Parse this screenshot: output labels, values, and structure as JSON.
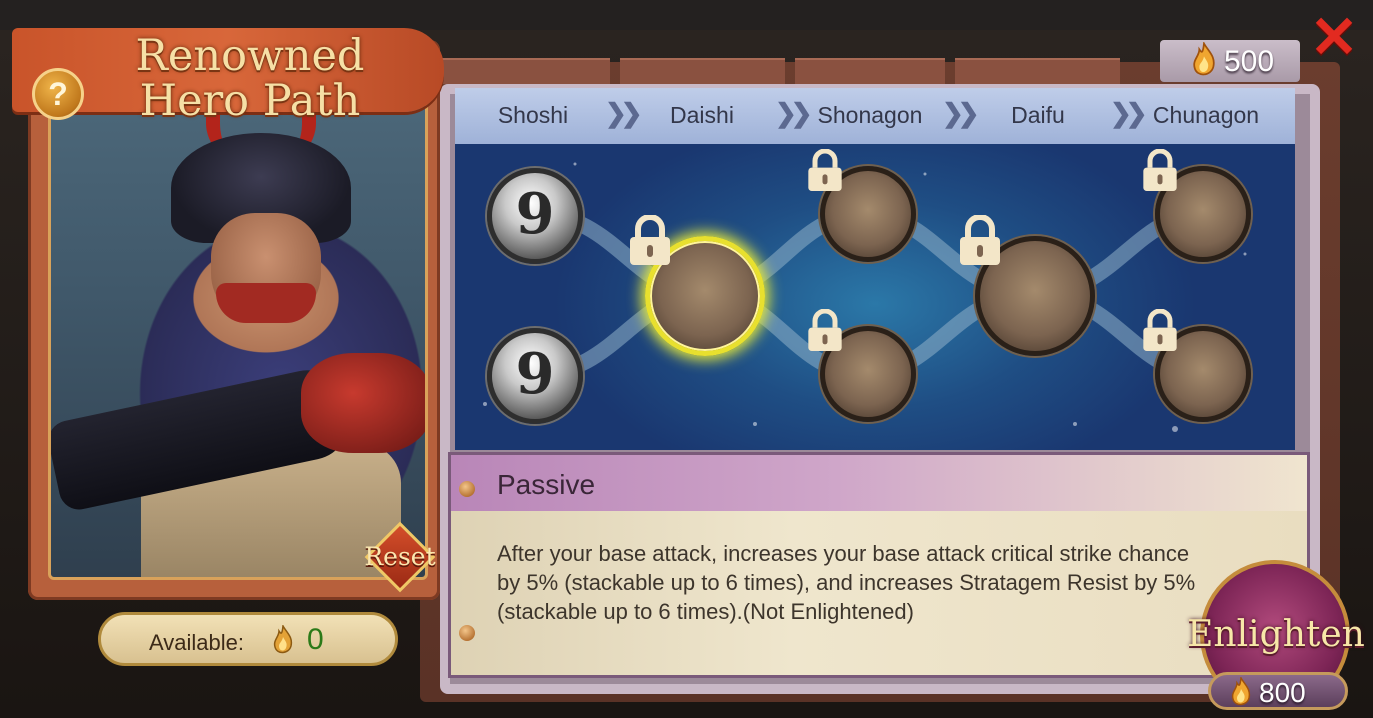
{
  "header": {
    "title_line1": "Renowned",
    "title_line2": "Hero Path",
    "help_icon": "question-mark-icon",
    "help_label": "?"
  },
  "currency": {
    "icon": "flame-coin-icon",
    "amount": "500"
  },
  "close": {
    "icon": "close-x-icon",
    "label": "✕"
  },
  "tiers": [
    "Shoshi",
    "Daishi",
    "Shonagon",
    "Daifu",
    "Chunagon"
  ],
  "tier_separator_icon": "double-chevron-right-icon",
  "nodes": [
    {
      "id": "node-1-top",
      "state": "unlocked",
      "glyph": "9"
    },
    {
      "id": "node-1-bottom",
      "state": "unlocked",
      "glyph": "9"
    },
    {
      "id": "node-2",
      "state": "locked-selected"
    },
    {
      "id": "node-3-top",
      "state": "locked"
    },
    {
      "id": "node-3-bottom",
      "state": "locked"
    },
    {
      "id": "node-4",
      "state": "locked"
    },
    {
      "id": "node-5-top",
      "state": "locked"
    },
    {
      "id": "node-5-bottom",
      "state": "locked"
    }
  ],
  "passive": {
    "title": "Passive",
    "description": "After your base attack, increases your base attack critical strike chance by 5% (stackable up to 6 times), and increases Stratagem Resist by 5% (stackable up to 6 times).(Not Enlightened)"
  },
  "hero_card": {
    "reset_label": "Reset",
    "available_label": "Available:",
    "available_value": "0",
    "available_icon": "flame-token-icon"
  },
  "enlighten": {
    "label": "Enlighten",
    "cost_icon": "flame-coin-icon",
    "cost": "800"
  },
  "colors": {
    "selected_glow": "#e8e02e",
    "title_gold": "#f6e0a6",
    "close_red": "#e22a20",
    "available_green": "#2c7a18"
  }
}
